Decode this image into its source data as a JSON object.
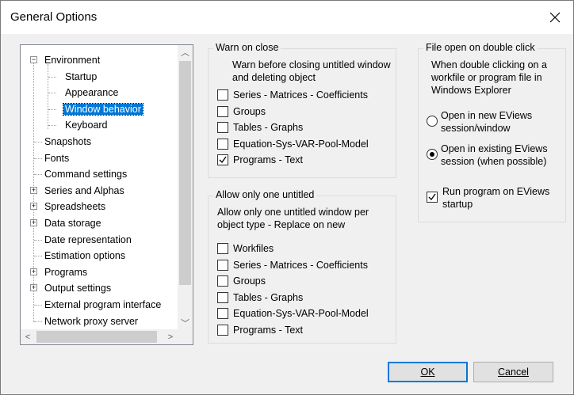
{
  "window": {
    "title": "General Options"
  },
  "tree": {
    "items": [
      {
        "label": "Environment",
        "expander": "−"
      },
      {
        "label": "Startup"
      },
      {
        "label": "Appearance"
      },
      {
        "label": "Window behavior",
        "selected": true
      },
      {
        "label": "Keyboard"
      },
      {
        "label": "Snapshots"
      },
      {
        "label": "Fonts"
      },
      {
        "label": "Command settings"
      },
      {
        "label": "Series and Alphas",
        "expander": "+"
      },
      {
        "label": "Spreadsheets",
        "expander": "+"
      },
      {
        "label": "Data storage",
        "expander": "+"
      },
      {
        "label": "Date representation"
      },
      {
        "label": "Estimation options"
      },
      {
        "label": "Programs",
        "expander": "+"
      },
      {
        "label": "Output settings",
        "expander": "+"
      },
      {
        "label": "External program interface"
      },
      {
        "label": "Network proxy server"
      }
    ]
  },
  "warn_on_close": {
    "title": "Warn on close",
    "description": "Warn before closing untitled window and deleting object",
    "options": [
      {
        "label": "Series - Matrices - Coefficients",
        "checked": false
      },
      {
        "label": "Groups",
        "checked": false
      },
      {
        "label": "Tables - Graphs",
        "checked": false
      },
      {
        "label": "Equation-Sys-VAR-Pool-Model",
        "checked": false
      },
      {
        "label": "Programs - Text",
        "checked": true
      }
    ]
  },
  "allow_one_untitled": {
    "title": "Allow only one untitled",
    "description": "Allow only one untitled window per object type - Replace on new",
    "options": [
      {
        "label": "Workfiles",
        "checked": false
      },
      {
        "label": "Series - Matrices - Coefficients",
        "checked": false
      },
      {
        "label": "Groups",
        "checked": false
      },
      {
        "label": "Tables - Graphs",
        "checked": false
      },
      {
        "label": "Equation-Sys-VAR-Pool-Model",
        "checked": false
      },
      {
        "label": "Programs - Text",
        "checked": false
      }
    ]
  },
  "file_open": {
    "title": "File open on double click",
    "description": "When double clicking on a workfile or program file in Windows Explorer",
    "radio_new": {
      "label": "Open in new EViews session/window",
      "selected": false
    },
    "radio_existing": {
      "label": "Open in existing EViews session (when possible)",
      "selected": true
    },
    "run_program": {
      "label": "Run program on EViews startup",
      "checked": true
    }
  },
  "buttons": {
    "ok": "OK",
    "cancel": "Cancel"
  },
  "colors": {
    "selection": "#0078d7",
    "window_bg": "#f0f0f0"
  }
}
